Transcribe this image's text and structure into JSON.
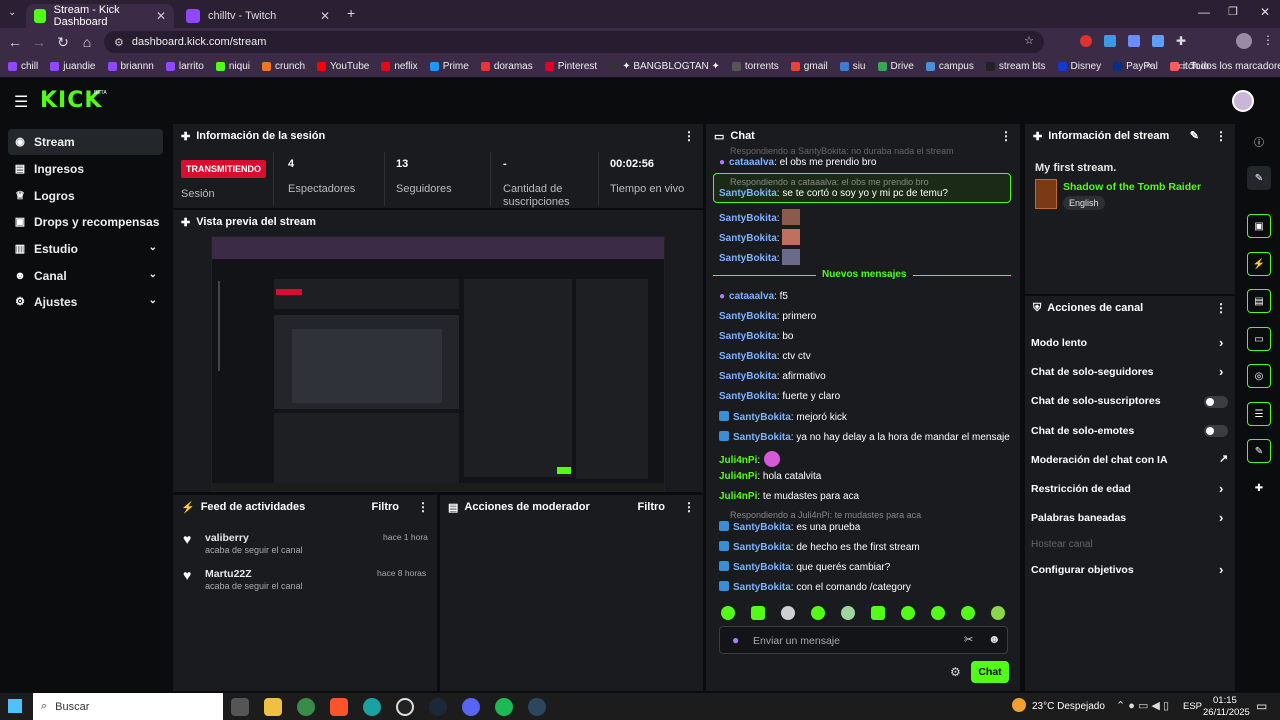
{
  "browser": {
    "tabs": [
      {
        "title": "Stream - Kick Dashboard",
        "active": true
      },
      {
        "title": "chilltv - Twitch",
        "active": false
      }
    ],
    "url": "dashboard.kick.com/stream",
    "bookmarks": [
      "chill",
      "juandie",
      "briannn",
      "larrito",
      "niqui",
      "crunch",
      "YouTube",
      "neflix",
      "Prime",
      "doramas",
      "Pinterest",
      "✦ BANGBLOGTAN ✦",
      "torrents",
      "gmail",
      "siu",
      "Drive",
      "campus",
      "stream bts",
      "Disney",
      "PayPal",
      "itch.io"
    ],
    "bookmarks_more": "»",
    "all_bookmarks": "Todos los marcadores"
  },
  "kick": {
    "logo": "KICK",
    "logo_beta": "BETA"
  },
  "sidebar": {
    "items": [
      {
        "label": "Stream"
      },
      {
        "label": "Ingresos"
      },
      {
        "label": "Logros"
      },
      {
        "label": "Drops y recompensas"
      },
      {
        "label": "Estudio"
      },
      {
        "label": "Canal"
      },
      {
        "label": "Ajustes"
      }
    ]
  },
  "session": {
    "title": "Información de la sesión",
    "live_badge": "TRANSMITIENDO",
    "session_label": "Sesión",
    "stats": [
      {
        "value": "4",
        "label": "Espectadores"
      },
      {
        "value": "13",
        "label": "Seguidores"
      },
      {
        "value": "-",
        "label": "Cantidad de suscripciones"
      },
      {
        "value": "00:02:56",
        "label": "Tiempo en vivo"
      }
    ]
  },
  "preview": {
    "title": "Vista previa del stream"
  },
  "feed": {
    "title": "Feed de actividades",
    "filter": "Filtro",
    "items": [
      {
        "user": "valiberry",
        "action": "acaba de seguir el canal",
        "time": "hace 1 hora"
      },
      {
        "user": "Martu22Z",
        "action": "acaba de seguir el canal",
        "time": "hace 8 horas"
      }
    ]
  },
  "mod": {
    "title": "Acciones de moderador",
    "filter": "Filtro"
  },
  "chat": {
    "title": "Chat",
    "top_reply": "Respondiendo a SantyBokita: no duraba nada el stream",
    "m0": {
      "user": "cataaalva",
      "text": "el obs me prendio bro"
    },
    "highlight_reply": "Respondiendo a cataaalva: el obs me prendio bro",
    "highlight": {
      "user": "SantyBokita",
      "text": "se te cortó o soy yo y mi pc de temu?"
    },
    "m1": {
      "user": "SantyBokita",
      "text": ":"
    },
    "m2": {
      "user": "SantyBokita",
      "text": ":"
    },
    "m3": {
      "user": "SantyBokita",
      "text": ":"
    },
    "new_messages": "Nuevos mensajes",
    "m4": {
      "user": "cataaalva",
      "text": "f5"
    },
    "m5": {
      "user": "SantyBokita",
      "text": "primero"
    },
    "m6": {
      "user": "SantyBokita",
      "text": "bo"
    },
    "m7": {
      "user": "SantyBokita",
      "text": "ctv ctv"
    },
    "m8": {
      "user": "SantyBokita",
      "text": "afirmativo"
    },
    "m9": {
      "user": "SantyBokita",
      "text": "fuerte y claro"
    },
    "m10": {
      "user": "SantyBokita",
      "text": "mejoró kick"
    },
    "m11": {
      "user": "SantyBokita",
      "text": "ya no hay delay a la hora de mandar el mensaje"
    },
    "m12": {
      "user": "Juli4nPi",
      "text": ":"
    },
    "m13": {
      "user": "Juli4nPi",
      "text": "hola catalvita"
    },
    "m14": {
      "user": "Juli4nPi",
      "text": "te mudastes para aca"
    },
    "reply2": "Respondiendo a Juli4nPi: te mudastes para aca",
    "m15": {
      "user": "SantyBokita",
      "text": "es una prueba"
    },
    "m16": {
      "user": "SantyBokita",
      "text": "de hecho es the first stream"
    },
    "m17": {
      "user": "SantyBokita",
      "text": "que querés cambiar?"
    },
    "m18": {
      "user": "SantyBokita",
      "text": "con el comando /category"
    },
    "input_placeholder": "Enviar un mensaje",
    "send": "Chat"
  },
  "stream_info": {
    "title": "Información del stream",
    "stream_title": "My first stream.",
    "category": "Shadow of the Tomb Raider",
    "language": "English"
  },
  "channel_actions": {
    "title": "Acciones de canal",
    "items": [
      {
        "label": "Modo lento"
      },
      {
        "label": "Chat de solo-seguidores"
      },
      {
        "label": "Chat de solo-suscriptores"
      },
      {
        "label": "Chat de solo-emotes"
      },
      {
        "label": "Moderación del chat con IA"
      },
      {
        "label": "Restricción de edad"
      },
      {
        "label": "Palabras baneadas"
      },
      {
        "label": "Hostear canal"
      },
      {
        "label": "Configurar objetivos"
      }
    ]
  },
  "taskbar": {
    "search": "Buscar",
    "weather": "23°C  Despejado",
    "lang": "ESP",
    "time": "01:15",
    "date": "26/11/2025"
  },
  "colors": {
    "accent": "#53fc18",
    "live": "#d90d2f",
    "panel": "#191b1f",
    "bg": "#0b0c0d"
  }
}
